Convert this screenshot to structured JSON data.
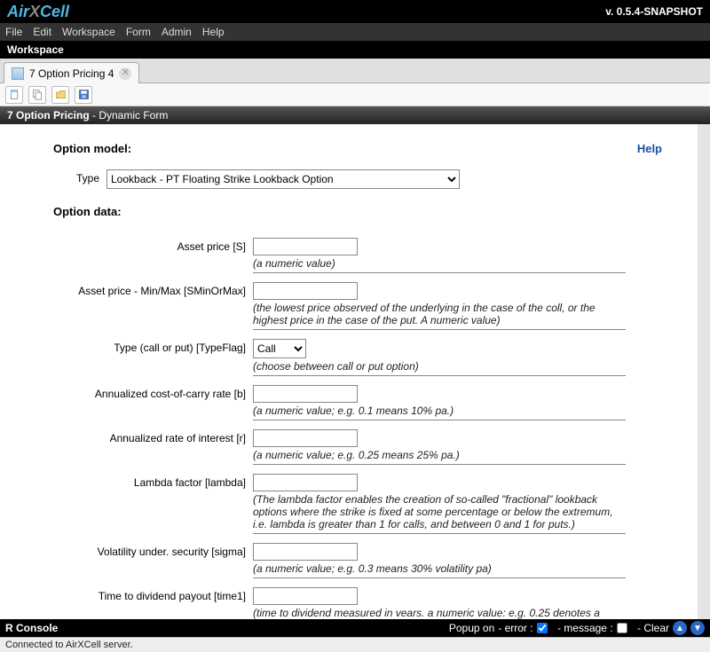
{
  "brand": {
    "air": "Air",
    "x": "X",
    "cell": "Cell"
  },
  "version": "v. 0.5.4-SNAPSHOT",
  "menu": {
    "file": "File",
    "edit": "Edit",
    "workspace": "Workspace",
    "form": "Form",
    "admin": "Admin",
    "help": "Help"
  },
  "workspace_label": "Workspace",
  "tab": {
    "label": "7 Option Pricing 4"
  },
  "section_title_bold": "7 Option Pricing",
  "section_title_rest": " - Dynamic Form",
  "help_link": "Help",
  "option_model_heading": "Option model:",
  "option_data_heading": "Option data:",
  "type_row": {
    "label": "Type",
    "value": "Lookback - PT Floating Strike Lookback Option"
  },
  "fields": {
    "asset_price": {
      "label": "Asset price [S]",
      "value": "",
      "hint": "(a numeric value)"
    },
    "asset_minmax": {
      "label": "Asset price - Min/Max [SMinOrMax]",
      "value": "",
      "hint": "(the lowest price observed of the underlying in the case of the coll, or the highest price in the case of the put. A numeric value)"
    },
    "type_flag": {
      "label": "Type (call or put) [TypeFlag]",
      "value": "Call",
      "hint": "(choose between call or put option)"
    },
    "carry_b": {
      "label": "Annualized cost-of-carry rate [b]",
      "value": "",
      "hint": "(a numeric value; e.g. 0.1 means 10% pa.)"
    },
    "rate_r": {
      "label": "Annualized rate of interest [r]",
      "value": "",
      "hint": "(a numeric value; e.g. 0.25 means 25% pa.)"
    },
    "lambda": {
      "label": "Lambda factor [lambda]",
      "value": "",
      "hint": "(The lambda factor enables the creation of so-called \"fractional\" lookback options where the strike is fixed at some percentage or below the extremum, i.e. lambda is greater than 1 for calls, and between 0 and 1 for puts.)"
    },
    "sigma": {
      "label": "Volatility under. security [sigma]",
      "value": "",
      "hint": "(a numeric value; e.g. 0.3 means 30% volatility pa)"
    },
    "time1": {
      "label": "Time to dividend payout [time1]",
      "value": "",
      "hint": "(time to dividend measured in vears. a numeric value: e.g. 0.25 denotes a"
    }
  },
  "console": {
    "label": "R Console",
    "popup_on": "Popup on",
    "error": "- error :",
    "message": "- message :",
    "clear": "-  Clear",
    "error_checked": true,
    "message_checked": false
  },
  "status": "Connected to AirXCell server."
}
